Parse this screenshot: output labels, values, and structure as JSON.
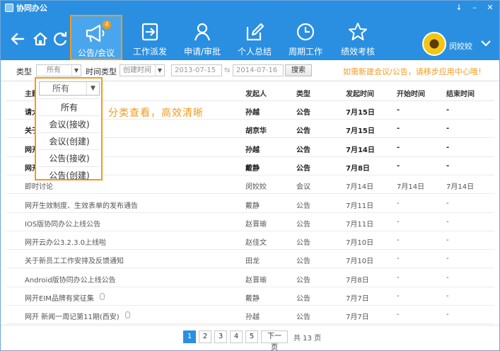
{
  "window": {
    "title": "协同办公",
    "controls": [
      "↓",
      "–",
      "✕"
    ]
  },
  "toolbar": {
    "nav": {
      "back_icon": "back-arrow-icon",
      "home_icon": "home-icon",
      "refresh_icon": "refresh-icon"
    },
    "tools": [
      {
        "label": "公告/会议",
        "icon": "megaphone-icon",
        "badge": "4",
        "active": true
      },
      {
        "label": "工作派发",
        "icon": "assign-icon"
      },
      {
        "label": "申请/审批",
        "icon": "person-icon"
      },
      {
        "label": "个人总结",
        "icon": "edit-icon"
      },
      {
        "label": "周期工作",
        "icon": "clock-icon"
      },
      {
        "label": "绩效考核",
        "icon": "star-icon"
      }
    ],
    "user": {
      "name": "闵姣姣"
    }
  },
  "filters": {
    "type_label": "类型",
    "type_value": "所有",
    "time_type_label": "时间类型",
    "time_type_value": "创建时间",
    "date_from": "2013-07-15",
    "date_to": "2014-07-16",
    "search_label": "搜索",
    "hint": "如需新建会议/公告，请移步应用中心哦！"
  },
  "dropdown": {
    "selected": "所有",
    "options": [
      "所有",
      "会议(接收)",
      "会议(创建)",
      "公告(接收)",
      "公告(创建)"
    ],
    "callout": "分类查看，高效清晰"
  },
  "table": {
    "headers": [
      "主题",
      "发起人",
      "类型",
      "发起时间",
      "开始时间",
      "结束时间"
    ],
    "rows": [
      {
        "subject": "请大",
        "sender": "孙越",
        "type": "公告",
        "sent": "7月15日",
        "start": "-",
        "end": "-",
        "bold": true,
        "attach": false
      },
      {
        "subject": "关于求反馈",
        "sender": "胡京华",
        "type": "公告",
        "sent": "7月15日",
        "start": "-",
        "end": "-",
        "bold": true,
        "attach": false
      },
      {
        "subject": "网开期(西安)",
        "sender": "孙越",
        "type": "公告",
        "sent": "7月14日",
        "start": "-",
        "end": "-",
        "bold": true,
        "attach": false
      },
      {
        "subject": "网开期(北京)",
        "sender": "戴静",
        "type": "公告",
        "sent": "7月8日",
        "start": "-",
        "end": "-",
        "bold": true,
        "attach": true
      },
      {
        "subject": "即时讨论",
        "sender": "闵姣姣",
        "type": "会议",
        "sent": "7月14日",
        "start": "7月14日",
        "end": "7月14日",
        "bold": false,
        "attach": false
      },
      {
        "subject": "网开生效制度、生效表单的发布通告",
        "sender": "戴静",
        "type": "公告",
        "sent": "7月11日",
        "start": "-",
        "end": "-",
        "bold": false,
        "attach": false
      },
      {
        "subject": "IOS版协同办公上线公告",
        "sender": "赵晋瑜",
        "type": "公告",
        "sent": "7月11日",
        "start": "-",
        "end": "-",
        "bold": false,
        "attach": false
      },
      {
        "subject": "网开云办公3.2.3.0上线啦",
        "sender": "赵佳文",
        "type": "公告",
        "sent": "7月10日",
        "start": "-",
        "end": "-",
        "bold": false,
        "attach": false
      },
      {
        "subject": "关于新员工工作安排及反馈通知",
        "sender": "田龙",
        "type": "公告",
        "sent": "7月10日",
        "start": "-",
        "end": "-",
        "bold": false,
        "attach": false
      },
      {
        "subject": "Android版协同办公上线公告",
        "sender": "赵晋瑜",
        "type": "公告",
        "sent": "7月8日",
        "start": "-",
        "end": "-",
        "bold": false,
        "attach": false
      },
      {
        "subject": "网开EIM品牌有奖征集",
        "sender": "戴静",
        "type": "公告",
        "sent": "7月7日",
        "start": "-",
        "end": "-",
        "bold": false,
        "attach": true
      },
      {
        "subject": "网开 新闻一周记第11期(西安)",
        "sender": "孙越",
        "type": "公告",
        "sent": "7月7日",
        "start": "-",
        "end": "-",
        "bold": false,
        "attach": true
      }
    ]
  },
  "pagination": {
    "pages": [
      "1",
      "2",
      "3",
      "4",
      "5"
    ],
    "current": "1",
    "next_label": "下一页",
    "total": "共 13 页"
  },
  "colors": {
    "primary": "#2a8fe0",
    "accent": "#f29a1d"
  }
}
